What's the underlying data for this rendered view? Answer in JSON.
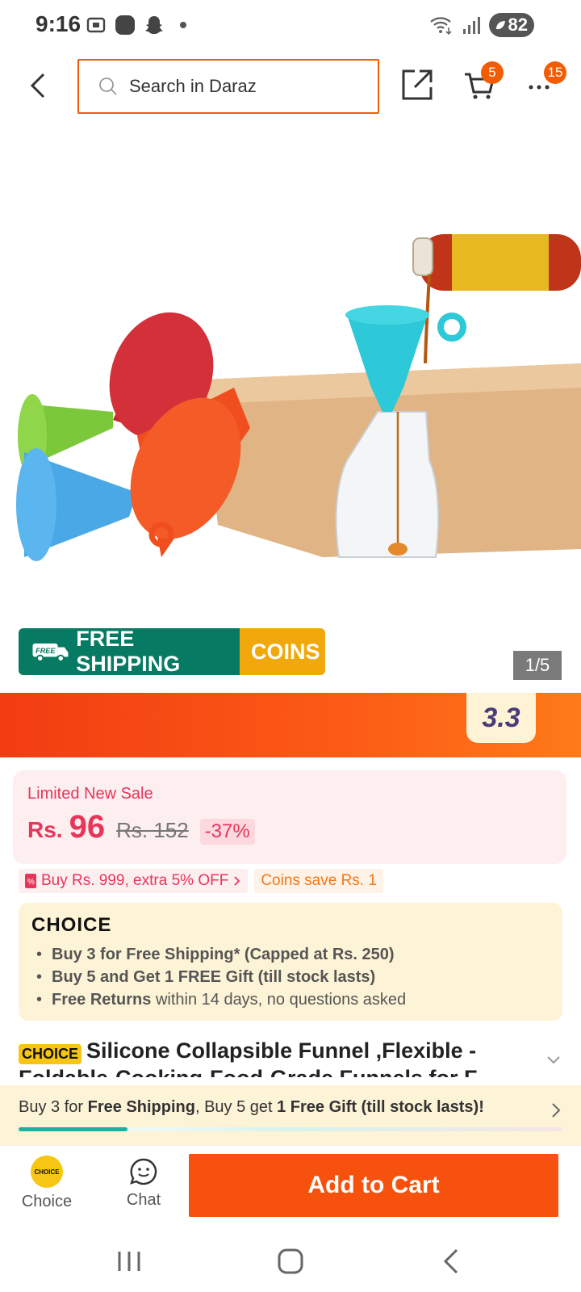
{
  "status_bar": {
    "time": "9:16",
    "battery": "82"
  },
  "header": {
    "search_placeholder": "Search in Daraz",
    "cart_count": "5",
    "more_count": "15"
  },
  "gallery": {
    "pager": "1/5",
    "shipping_label": "FREE SHIPPING",
    "shipping_free_tag": "FREE",
    "coins_label": "COINS",
    "colors": [
      "#7cc83b",
      "#c5262e",
      "#4aa8e6",
      "#f04e1e",
      "#2ec9d8"
    ]
  },
  "campaign": {
    "badge": "3.3"
  },
  "price": {
    "label": "Limited New Sale",
    "currency": "Rs.",
    "current": "96",
    "original": "Rs. 152",
    "discount": "-37%"
  },
  "promos": {
    "voucher": "Buy Rs. 999, extra 5% OFF",
    "coins": "Coins save Rs. 1"
  },
  "choice": {
    "logo": "CHOICE",
    "items": [
      {
        "bold": "Buy 3 for  Free Shipping* (Capped at Rs. 250)",
        "rest": ""
      },
      {
        "bold": "Buy 5 and Get 1 FREE Gift (till stock lasts)",
        "rest": ""
      },
      {
        "bold": "Free Returns",
        "rest": " within 14 days, no questions asked"
      }
    ]
  },
  "product": {
    "chip": "CHOICE",
    "title": "Silicone Collapsible Funnel ,Flexible -Foldable-Cooking-Food-Grade Funnels for F"
  },
  "promo_bar": {
    "p1": "Buy 3 for ",
    "b1": "Free Shipping",
    "p2": ", Buy 5 get ",
    "b2": "1 Free Gift (till stock lasts)!",
    "progress": 0.2
  },
  "actions": {
    "choice_label": "Choice",
    "choice_icon_text": "CHOICE",
    "chat_label": "Chat",
    "add_to_cart": "Add to Cart"
  }
}
